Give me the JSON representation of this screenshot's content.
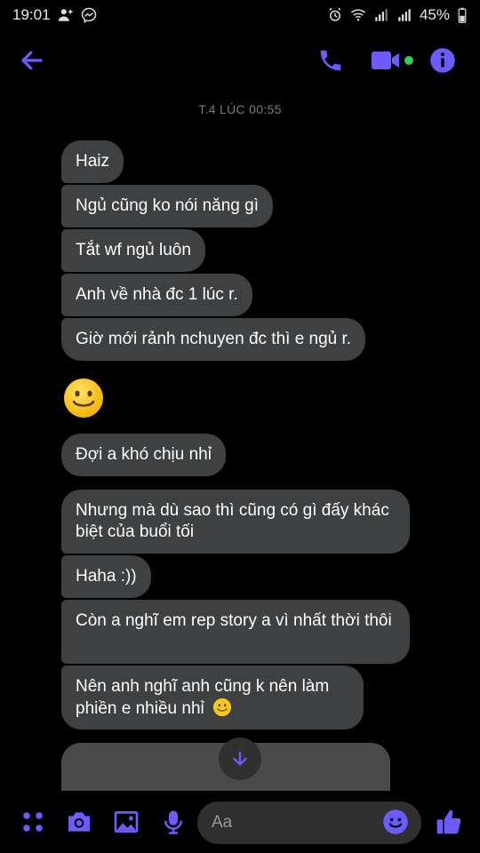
{
  "status_bar": {
    "time": "19:01",
    "battery": "45%"
  },
  "header": {
    "back_icon": "back-arrow-icon",
    "call_icon": "phone-icon",
    "video_icon": "video-camera-icon",
    "info_icon": "info-icon",
    "accent_color": "#6c5cff",
    "online_color": "#31d158"
  },
  "thread": {
    "timestamp": "T.4 LÚC 00:55",
    "messages": [
      {
        "text": "Haiz"
      },
      {
        "text": "Ngủ cũng ko nói năng gì"
      },
      {
        "text": "Tắt wf ngủ luôn"
      },
      {
        "text": "Anh về nhà đc 1 lúc r."
      },
      {
        "text": "Giờ mới rảnh nchuyen đc thì e ngủ r."
      },
      {
        "text": "Đợi a khó chịu nhỉ"
      },
      {
        "text": "Nhưng mà dù sao thì cũng có gì đấy khác biệt của buổi tối"
      },
      {
        "text": "Haha :))"
      },
      {
        "text": "Còn a nghĩ em rep story a vì nhất thời thôi"
      },
      {
        "text": "Nên anh nghĩ anh cũng k nên làm phiền e nhiều nhỉ"
      }
    ],
    "bubble_color": "#3e4042"
  },
  "composer": {
    "placeholder": "Aa",
    "icons": [
      "menu-dots-icon",
      "camera-icon",
      "gallery-icon",
      "microphone-icon",
      "emoji-icon",
      "thumbs-up-icon"
    ]
  }
}
